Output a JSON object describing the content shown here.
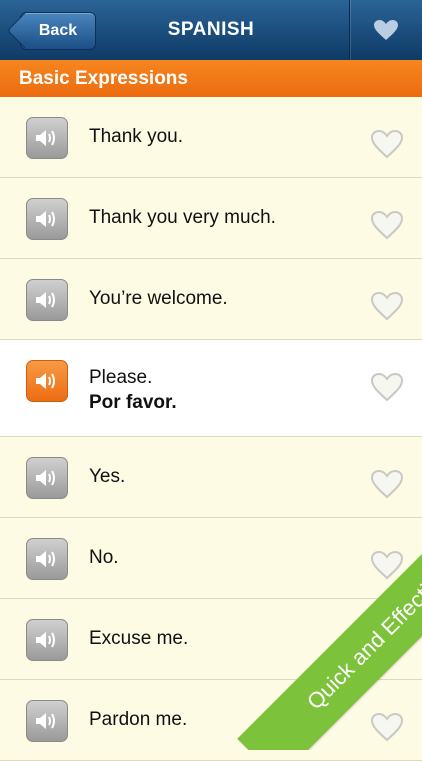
{
  "navbar": {
    "back_label": "Back",
    "title": "SPANISH",
    "favorites_icon": "heart-icon"
  },
  "section": {
    "title": "Basic Expressions"
  },
  "rows": [
    {
      "phrase": "Thank you.",
      "translation": ""
    },
    {
      "phrase": "Thank you very much.",
      "translation": ""
    },
    {
      "phrase": "You’re welcome.",
      "translation": ""
    },
    {
      "phrase": "Please.",
      "translation": "Por favor."
    },
    {
      "phrase": "Yes.",
      "translation": ""
    },
    {
      "phrase": "No.",
      "translation": ""
    },
    {
      "phrase": "Excuse me.",
      "translation": ""
    },
    {
      "phrase": "Pardon me.",
      "translation": ""
    }
  ],
  "ribbon": {
    "text": "Quick and Effective"
  },
  "colors": {
    "navbar": "#1b4f85",
    "accent": "#ec6c10",
    "ribbon": "#7cc23a",
    "background": "#fdfbe4"
  }
}
